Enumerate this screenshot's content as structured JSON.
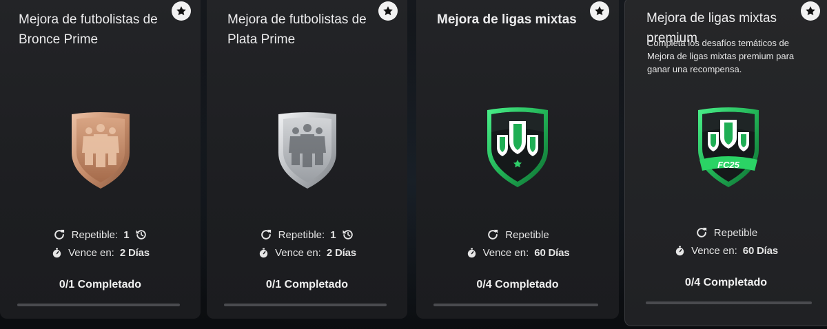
{
  "cards": [
    {
      "title": "Mejora de futbolistas de Bronce Prime",
      "repeat_label": "Repetible:",
      "repeat_count": "1",
      "expire_label": "Vence en:",
      "expire_value": "2 Días",
      "progress_text": "0/1 Completado",
      "progress": 0,
      "badge": "bronze-players-badge"
    },
    {
      "title": "Mejora de futbolistas de Plata Prime",
      "repeat_label": "Repetible:",
      "repeat_count": "1",
      "expire_label": "Vence en:",
      "expire_value": "2 Días",
      "progress_text": "0/1 Completado",
      "progress": 0,
      "badge": "silver-players-badge"
    },
    {
      "title": "Mejora de ligas mixtas",
      "repeat_label": "Repetible",
      "expire_label": "Vence en:",
      "expire_value": "60 Días",
      "progress_text": "0/4 Completado",
      "progress": 0,
      "badge": "mixed-leagues-badge"
    },
    {
      "title": "Mejora de ligas mixtas premium",
      "description": "Completa los desafíos temáticos de Mejora de ligas mixtas premium para ganar una recompensa.",
      "repeat_label": "Repetible",
      "expire_label": "Vence en:",
      "expire_value": "60 Días",
      "progress_text": "0/4 Completado",
      "progress": 0,
      "badge": "premium-mixed-leagues-badge",
      "badge_text": "FC25"
    }
  ],
  "colors": {
    "bronze": "#c08a6a",
    "silver": "#b9bcc0",
    "green": "#2fd06a",
    "card_bg": "#222326"
  }
}
